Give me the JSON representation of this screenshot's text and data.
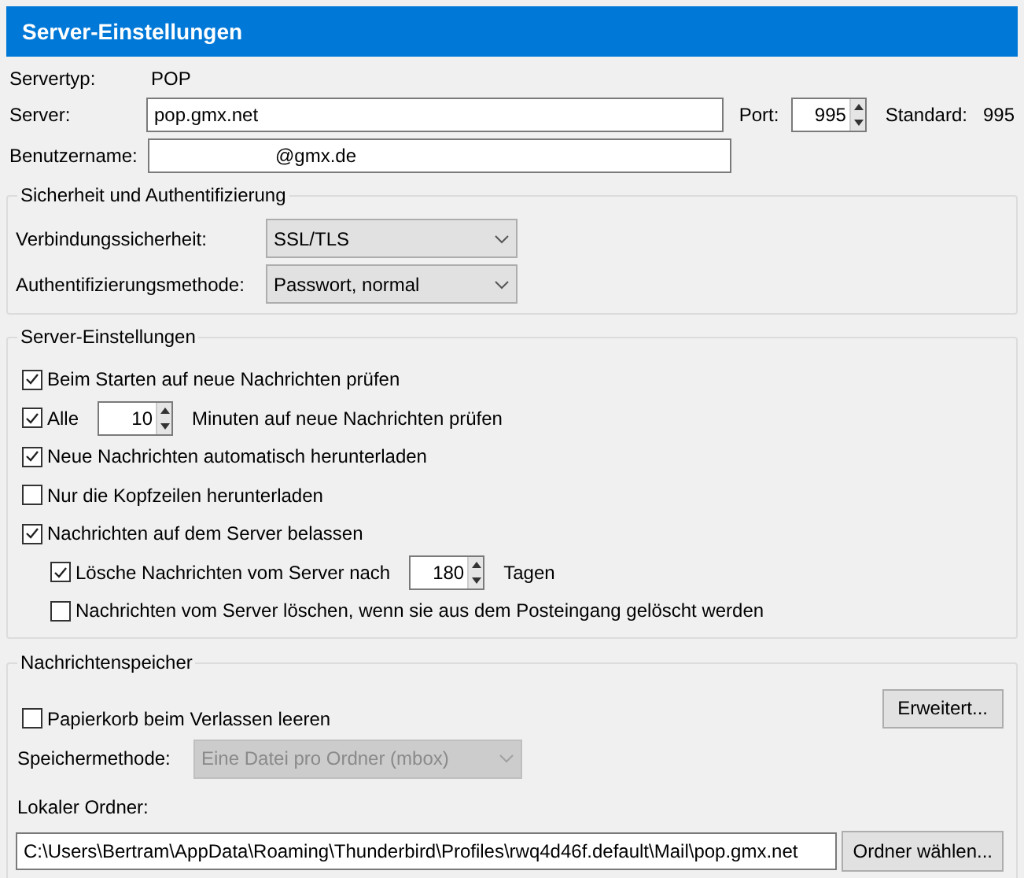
{
  "header": {
    "title": "Server-Einstellungen"
  },
  "server_type": {
    "label": "Servertyp:",
    "value": "POP"
  },
  "server": {
    "label": "Server:",
    "value": "pop.gmx.net",
    "port_label": "Port:",
    "port": "995",
    "default_label": "Standard:",
    "default": "995"
  },
  "username": {
    "label": "Benutzername:",
    "value": "@gmx.de"
  },
  "security": {
    "title": "Sicherheit und Authentifizierung",
    "fields": [
      {
        "label": "Verbindungssicherheit:",
        "value": "SSL/TLS"
      },
      {
        "label": "Authentifizierungsmethode:",
        "value": "Passwort, normal"
      }
    ]
  },
  "server_settings": {
    "title": "Server-Einstellungen",
    "items": [
      {
        "kind": "check",
        "label": "Beim Starten auf neue Nachrichten prüfen",
        "checked": true
      },
      {
        "kind": "spin",
        "label": "Alle",
        "checked": true,
        "value": "10",
        "suffix": "Minuten auf neue Nachrichten prüfen"
      },
      {
        "kind": "check",
        "label": "Neue Nachrichten automatisch herunterladen",
        "checked": true
      },
      {
        "kind": "check",
        "label": "Nur die Kopfzeilen herunterladen",
        "checked": false
      },
      {
        "kind": "check",
        "label": "Nachrichten auf dem Server belassen",
        "checked": true,
        "children": [
          {
            "kind": "spin",
            "label": "Lösche Nachrichten vom Server nach",
            "checked": true,
            "value": "180",
            "suffix": "Tagen"
          },
          {
            "kind": "check",
            "label": "Nachrichten vom Server löschen, wenn sie aus dem Posteingang gelöscht werden",
            "checked": false
          }
        ]
      }
    ]
  },
  "storage": {
    "title": "Nachrichtenspeicher",
    "empty_trash": {
      "label": "Papierkorb beim Verlassen leeren",
      "checked": false
    },
    "advanced_button": "Erweitert...",
    "method": {
      "label": "Speichermethode:",
      "value": "Eine Datei pro Ordner (mbox)",
      "disabled": true
    },
    "folder_label": "Lokaler Ordner:",
    "folder": "C:\\Users\\Bertram\\AppData\\Roaming\\Thunderbird\\Profiles\\rwq4d46f.default\\Mail\\pop.gmx.net",
    "choose_button": "Ordner wählen..."
  }
}
